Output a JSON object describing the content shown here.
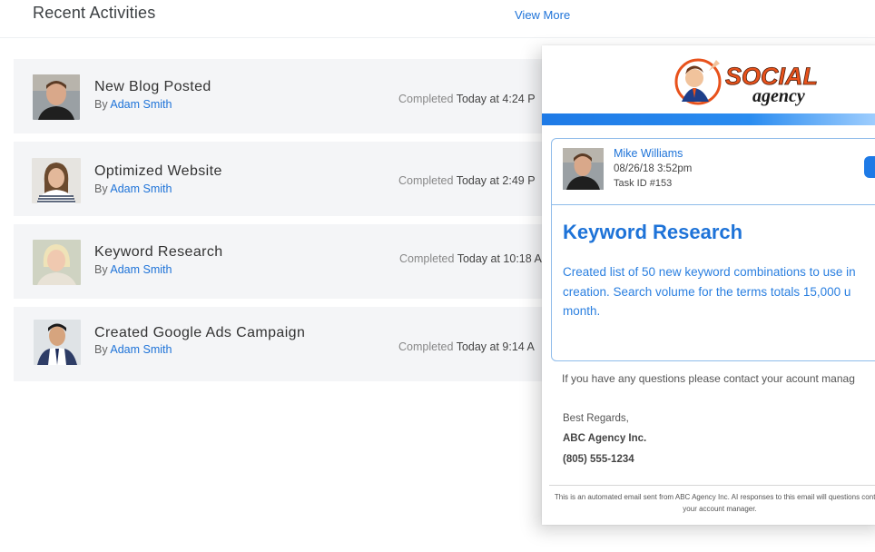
{
  "header": {
    "title": "Recent Activities",
    "view_more": "View More"
  },
  "activities": [
    {
      "title": "New Blog Posted",
      "by": "By",
      "author": "Adam Smith",
      "status": "Completed",
      "when": "Today at 4:24 P"
    },
    {
      "title": "Optimized Website",
      "by": "By",
      "author": "Adam Smith",
      "status": "Completed",
      "when": "Today at 2:49 P"
    },
    {
      "title": "Keyword Research",
      "by": "By",
      "author": "Adam Smith",
      "status": "Completed",
      "when": "Today at 10:18 A"
    },
    {
      "title": "Created Google Ads Campaign",
      "by": "By",
      "author": "Adam Smith",
      "status": "Completed",
      "when": "Today at 9:14 A"
    }
  ],
  "email": {
    "logo_text_top": "SOCIAL",
    "logo_text_bottom": "agency",
    "assignee": "Mike Williams",
    "date": "08/26/18 3:52pm",
    "task_id": "Task ID #153",
    "task_title": "Keyword Research",
    "task_desc": "Created list of 50 new keyword combinations to use in creation. Search volume for the terms totals 15,000 u month.",
    "contact_line": "If you have any questions please contact your acount manag",
    "regards": "Best Regards,",
    "agency_name": "ABC Agency Inc.",
    "phone": "(805) 555-1234",
    "footer": "This is an automated email sent from ABC Agency Inc. AI responses to this email will questions contact your account manager."
  },
  "colors": {
    "accent": "#1e73d8",
    "row_bg": "#f4f5f7",
    "logo_orange": "#e8521c"
  }
}
